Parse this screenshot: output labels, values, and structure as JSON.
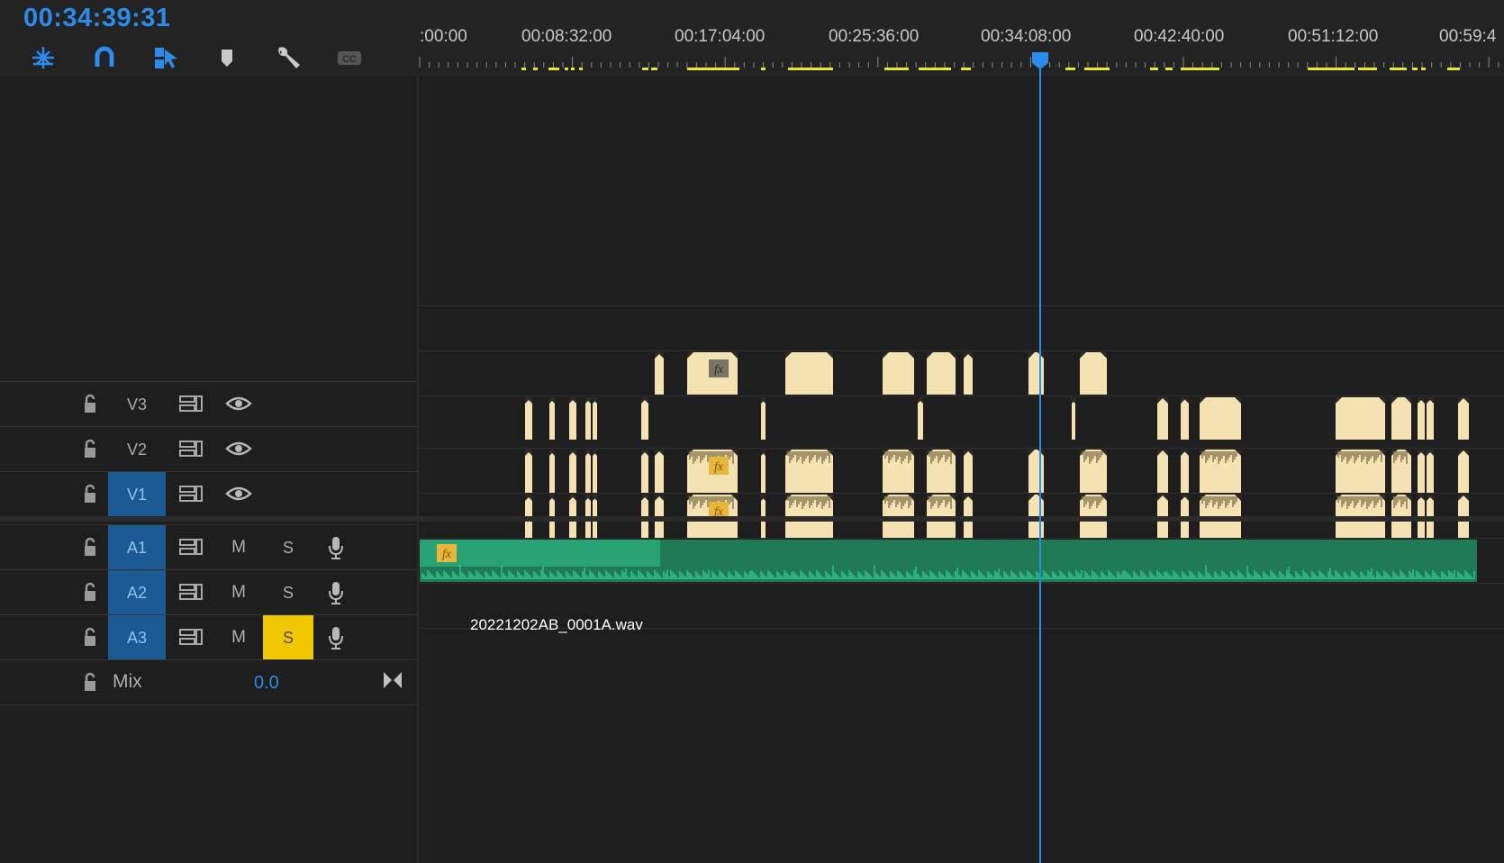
{
  "timecode": "00:34:39:31",
  "colors": {
    "accent": "#2d8ceb",
    "clip_fill": "#f5e2b3",
    "audio_clip": "#1f7a55",
    "waveform": "#35d39a",
    "solo_active": "#f0c800",
    "track_target": "#1b5a92",
    "marker_yellow": "#e9e62b"
  },
  "toolbar": {
    "tools": [
      {
        "icon": "insert-sequence-icon"
      },
      {
        "icon": "snap-magnet-icon"
      },
      {
        "icon": "linked-selection-icon"
      },
      {
        "icon": "add-marker-icon"
      },
      {
        "icon": "timeline-settings-wrench-icon"
      },
      {
        "icon": "captions-cc-icon"
      }
    ]
  },
  "ruler": {
    "labels": [
      ":00:00",
      "00:08:32:00",
      "00:17:04:00",
      "00:25:36:00",
      "00:34:08:00",
      "00:42:40:00",
      "00:51:12:00",
      "00:59:4"
    ]
  },
  "tracks": {
    "video": [
      {
        "name": "V3",
        "targeted": false
      },
      {
        "name": "V2",
        "targeted": false
      },
      {
        "name": "V1",
        "targeted": true
      }
    ],
    "audio": [
      {
        "name": "A1",
        "targeted": true,
        "mute": "M",
        "solo": "S",
        "solo_on": false
      },
      {
        "name": "A2",
        "targeted": true,
        "mute": "M",
        "solo": "S",
        "solo_on": false
      },
      {
        "name": "A3",
        "targeted": true,
        "mute": "M",
        "solo": "S",
        "solo_on": true
      }
    ],
    "mix": {
      "label": "Mix",
      "value": "0.0"
    }
  },
  "clips": {
    "a3_clip_name": "20221202AB_0001A.wav"
  }
}
